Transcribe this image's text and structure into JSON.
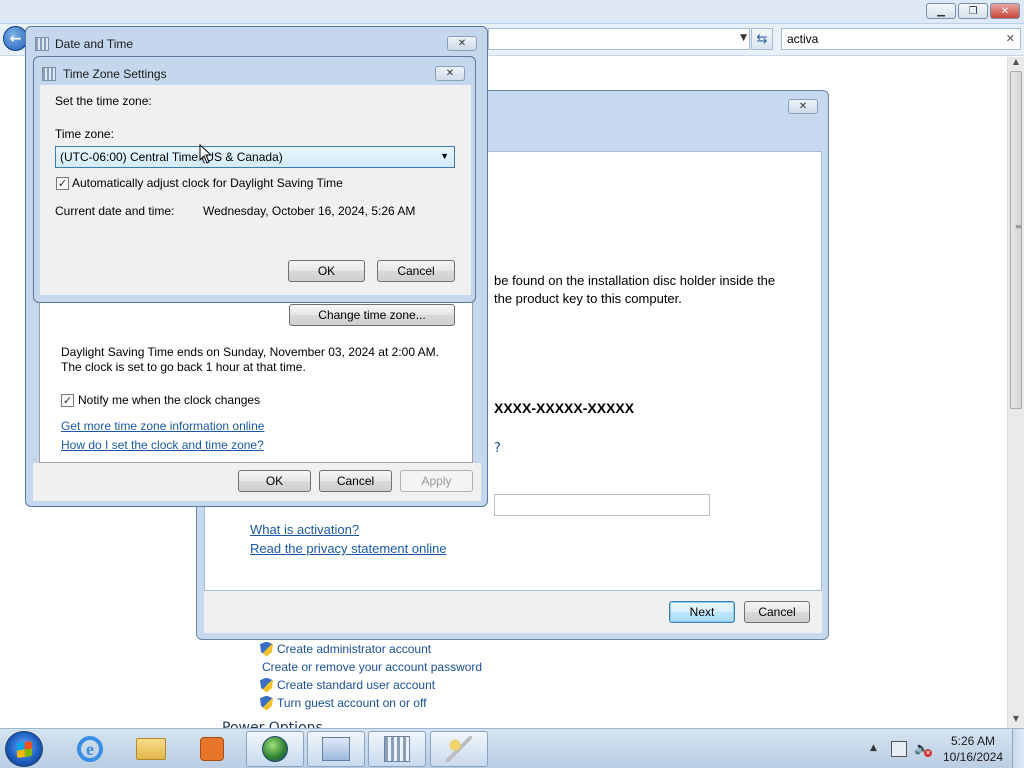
{
  "control_panel": {
    "search_value": "activa",
    "links": [
      {
        "label": "Create administrator account",
        "shield": true
      },
      {
        "label": "Create or remove your account password",
        "shield": false
      },
      {
        "label": "Create standard user account",
        "shield": true
      },
      {
        "label": "Turn guest account on or off",
        "shield": true
      }
    ],
    "section_fragment": "Power Options"
  },
  "activation": {
    "text_line1": "be found on the installation disc holder inside the",
    "text_line2": "the product key to this computer.",
    "product_key_fragment": "XXXX-XXXXX-XXXXX",
    "link_what": "What is activation?",
    "link_privacy": "Read the privacy statement online",
    "next_label": "Next",
    "cancel_label": "Cancel"
  },
  "date_time": {
    "title": "Date and Time",
    "change_tz_label": "Change time zone...",
    "dst_note": "Daylight Saving Time ends on Sunday, November 03, 2024 at 2:00 AM. The clock is set to go back 1 hour at that time.",
    "notify_label": "Notify me when the clock changes",
    "notify_checked": true,
    "link_more_info": "Get more time zone information online",
    "link_howto": "How do I set the clock and time zone?",
    "ok_label": "OK",
    "cancel_label": "Cancel",
    "apply_label": "Apply"
  },
  "tz_settings": {
    "title": "Time Zone Settings",
    "set_label": "Set the time zone:",
    "tz_label": "Time zone:",
    "tz_value": "(UTC-06:00) Central Time (US & Canada)",
    "auto_dst_label": "Automatically adjust clock for Daylight Saving Time",
    "auto_dst_checked": true,
    "current_label": "Current date and time:",
    "current_value": "Wednesday, October 16, 2024, 5:26 AM",
    "ok_label": "OK",
    "cancel_label": "Cancel"
  },
  "taskbar": {
    "time": "5:26 AM",
    "date": "10/16/2024",
    "items": [
      "internet-explorer",
      "windows-explorer",
      "media-player",
      "network-globe",
      "control-panel",
      "date-time",
      "activation-keys"
    ]
  }
}
